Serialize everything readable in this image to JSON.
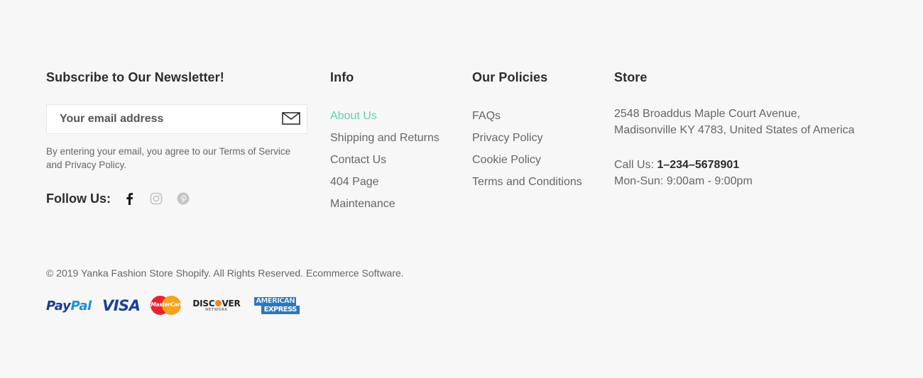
{
  "newsletter": {
    "title": "Subscribe to Our Newsletter!",
    "email_placeholder": "Your email address",
    "note": "By entering your email, you agree to our Terms of Service and Privacy Policy.",
    "follow_label": "Follow Us:",
    "social": [
      {
        "icon": "facebook-icon",
        "color": "#1a1a1a"
      },
      {
        "icon": "instagram-icon",
        "color": "#c4c4c4"
      },
      {
        "icon": "pinterest-icon",
        "color": "#c4c4c4"
      }
    ]
  },
  "info": {
    "title": "Info",
    "links": [
      "About Us",
      "Shipping and Returns",
      "Contact Us",
      "404 Page",
      "Maintenance"
    ],
    "active_link": "About Us"
  },
  "policies": {
    "title": "Our Policies",
    "links": [
      "FAQs",
      "Privacy Policy",
      "Cookie Policy",
      "Terms and Conditions"
    ]
  },
  "store": {
    "title": "Store",
    "address_line1": "2548 Broaddus Maple Court Avenue,",
    "address_line2": "Madisonville KY 4783, United States of America",
    "call_label": "Call Us: ",
    "phone": "1–234–5678901",
    "hours": "Mon-Sun: 9:00am - 9:00pm"
  },
  "copyright": "© 2019 Yanka Fashion Store Shopify. All Rights Reserved. Ecommerce Software.",
  "payments": {
    "paypal_pay": "Pay",
    "paypal_pal": "Pal",
    "visa": "VISA",
    "mastercard": "MasterCard",
    "discover_left": "DISC",
    "discover_right": "VER",
    "discover_sub": "NETWORK",
    "amex_line1": "AMERICAN",
    "amex_line2": "EXPRESS"
  },
  "colors": {
    "background": "#f7f7f7",
    "accent": "#5ecfb1",
    "heading": "#2c2c2c",
    "muted_text": "#666666"
  }
}
